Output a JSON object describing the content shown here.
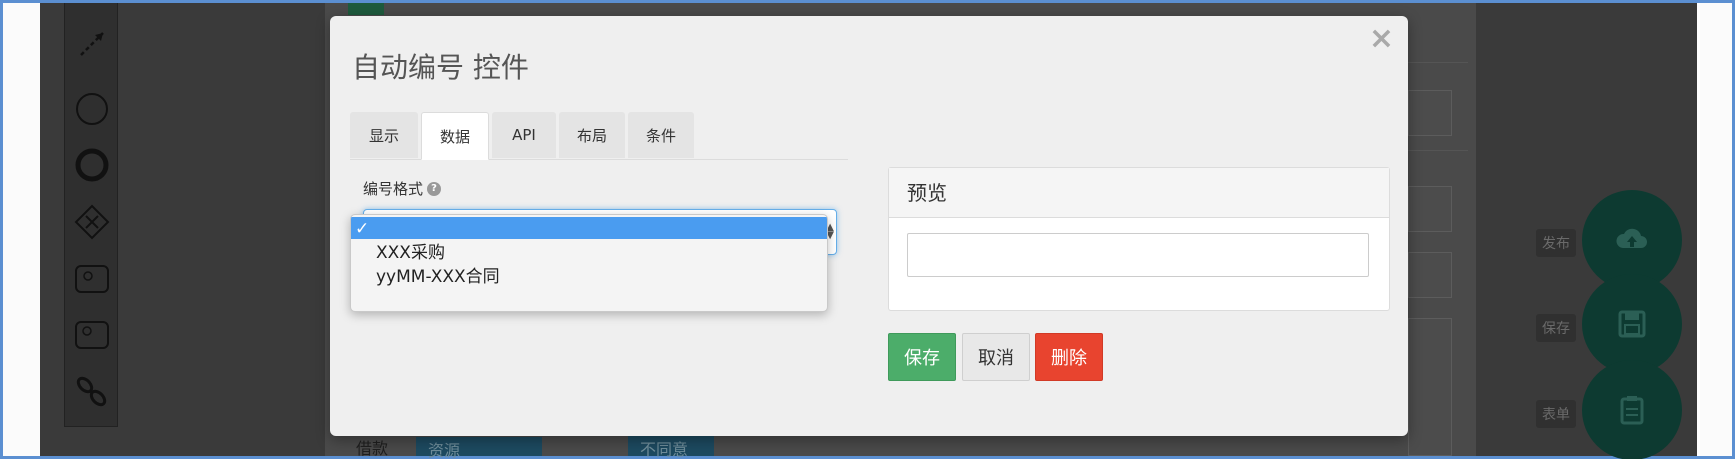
{
  "modal": {
    "title": "自动编号 控件",
    "close_label": "×",
    "tabs": [
      {
        "label": "显示",
        "active": false
      },
      {
        "label": "数据",
        "active": true
      },
      {
        "label": "API",
        "active": false
      },
      {
        "label": "布局",
        "active": false
      },
      {
        "label": "条件",
        "active": false
      }
    ],
    "field": {
      "label": "编号格式",
      "help_icon": "question-icon",
      "selected_value": "",
      "options": [
        {
          "label": "",
          "selected": true,
          "check": "✓"
        },
        {
          "label": "XXX采购",
          "selected": false
        },
        {
          "label": "yyMM-XXX合同",
          "selected": false
        }
      ]
    },
    "preview": {
      "title": "预览",
      "value": ""
    },
    "buttons": {
      "save": "保存",
      "cancel": "取消",
      "delete": "删除"
    }
  },
  "background": {
    "ghost_buttons": [
      "发布",
      "保存",
      "表单"
    ],
    "under_text_left": "借款",
    "under_teal_1": "资源",
    "under_teal_2": "不同意",
    "circle_icons": [
      "cloud-upload-icon",
      "floppy-save-icon",
      "clipboard-icon"
    ]
  },
  "colors": {
    "primary_save": "#4cad6a",
    "danger_delete": "#e8442f",
    "selection_blue": "#4a9cf0",
    "frame_border": "#5b8fd1"
  }
}
